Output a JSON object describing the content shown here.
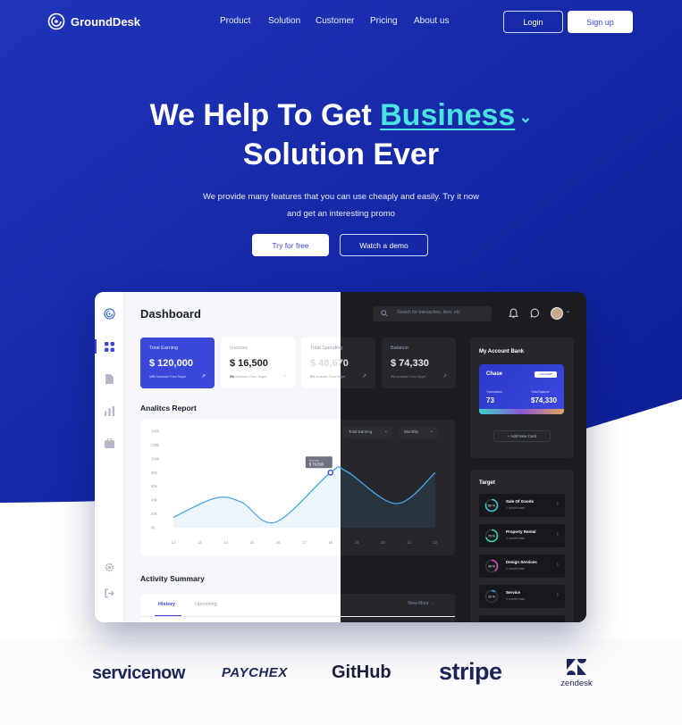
{
  "brand": {
    "name": "GroundDesk"
  },
  "nav": {
    "links": [
      "Product",
      "Solution",
      "Customer",
      "Pricing",
      "About us"
    ],
    "login_label": "Login",
    "signup_label": "Sign up"
  },
  "hero": {
    "headline_start": "We Help To Get",
    "headline_accent": "Business",
    "headline_end": "Solution Ever",
    "subtitle_line1": "We provide many features that you can use cheaply and easily. Try it now",
    "subtitle_line2": "and get an interesting promo",
    "try_label": "Try for free",
    "demo_label": "Watch a demo"
  },
  "dashboard": {
    "title": "Dashboard",
    "search_placeholder": "Search for transaction, item, etc",
    "stats": [
      {
        "label": "Total Earning",
        "value": "$ 120,000",
        "note_pct": "12%",
        "note": "Increase From Target",
        "arrow": "↗"
      },
      {
        "label": "Invoices",
        "value": "$ 16,500",
        "note_pct": "2%",
        "note": "Decrease From Target",
        "arrow": "↓"
      },
      {
        "label": "Total Spending",
        "value": "$ 48,670",
        "note_pct": "6%",
        "note": "Increase From Target",
        "arrow": "↗"
      },
      {
        "label": "Balance",
        "value": "$ 74,330",
        "note_pct": "3%",
        "note": "Increase From Target",
        "arrow": "↗"
      }
    ],
    "report_title": "Analitcs Report",
    "report_filter1": "Total Earning",
    "report_filter2": "Monthly",
    "tooltip_label": "Earnings",
    "tooltip_value": "$ 76,560",
    "activity_title": "Activity Summary",
    "tabs": [
      "History",
      "Upcoming"
    ],
    "view_more": "View More",
    "bank": {
      "title": "My Account Bank",
      "card_name": "Chase",
      "card_badge": "VISA/DEB",
      "transaction_label": "Transaction",
      "transaction_value": "73",
      "balance_label": "Total Balance",
      "balance_value": "$74,330",
      "add_card": "+ Add New Card"
    },
    "target": {
      "title": "Target",
      "items": [
        {
          "pct": "80 %",
          "name": "Sale Of Goods",
          "sub": "1 month base",
          "color": "#39c6d6",
          "progress": 0.8
        },
        {
          "pct": "70 %",
          "name": "Property Rental",
          "sub": "2 month base",
          "color": "#3bd4a4",
          "progress": 0.7
        },
        {
          "pct": "40 %",
          "name": "Design Services",
          "sub": "1 month base",
          "color": "#d64bc6",
          "progress": 0.4
        },
        {
          "pct": "10 %",
          "name": "Service",
          "sub": "4 month base",
          "color": "#39a6f0",
          "progress": 0.1
        }
      ]
    }
  },
  "chart_data": {
    "type": "area",
    "title": "Analitcs Report",
    "x": [
      "12",
      "13",
      "14",
      "15",
      "16",
      "17",
      "18",
      "19",
      "20",
      "21",
      "22"
    ],
    "y_ticks": [
      "0k",
      "20k",
      "40k",
      "60k",
      "80k",
      "100k",
      "120k",
      "140k"
    ],
    "series": [
      {
        "values": [
          [
            12,
            15
          ],
          [
            13.6,
            43
          ],
          [
            14.6,
            37
          ],
          [
            15.9,
            8
          ],
          [
            18,
            80
          ],
          [
            18.6,
            82
          ],
          [
            20.5,
            35
          ],
          [
            22,
            80
          ]
        ]
      }
    ],
    "highlight": {
      "x": 18,
      "label": "$ 76,560"
    },
    "ylim": [
      0,
      140
    ],
    "line_color": "#44a8e6"
  },
  "partners": [
    "servicenow",
    "PAYCHEX",
    "GitHub",
    "stripe",
    "zendesk"
  ],
  "colors": {
    "primary": "#3b47d8",
    "hero_top": "#1a28a8",
    "accent": "#4be3e0"
  }
}
